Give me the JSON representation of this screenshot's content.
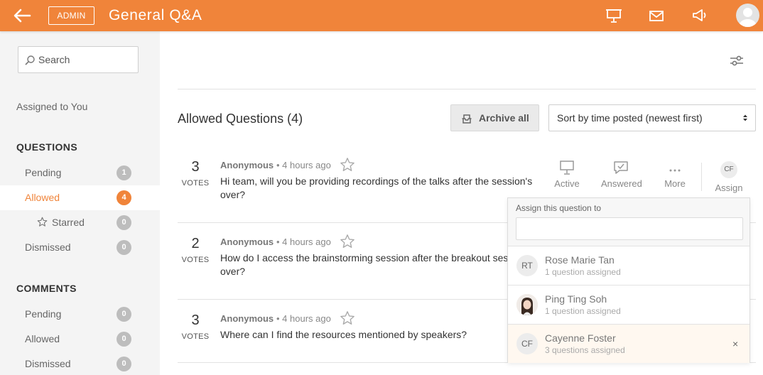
{
  "header": {
    "admin_label": "ADMIN",
    "title": "General Q&A",
    "accent_color": "#f0843a"
  },
  "sidebar": {
    "search_placeholder": "Search",
    "assigned_to_you": "Assigned to You",
    "questions_heading": "QUESTIONS",
    "questions": [
      {
        "label": "Pending",
        "count": "1"
      },
      {
        "label": "Allowed",
        "count": "4"
      },
      {
        "label": "Starred",
        "count": "0"
      },
      {
        "label": "Dismissed",
        "count": "0"
      }
    ],
    "comments_heading": "COMMENTS",
    "comments": [
      {
        "label": "Pending",
        "count": "0"
      },
      {
        "label": "Allowed",
        "count": "0"
      },
      {
        "label": "Dismissed",
        "count": "0"
      }
    ]
  },
  "main": {
    "list_title": "Allowed Questions (4)",
    "archive_label": "Archive all",
    "sort_label": "Sort by time posted (newest first)",
    "questions": [
      {
        "votes": "3",
        "votes_label": "VOTES",
        "author": "Anonymous",
        "time": "• 4 hours ago",
        "text": "Hi team, will you be providing recordings of the talks after the session's over?"
      },
      {
        "votes": "2",
        "votes_label": "VOTES",
        "author": "Anonymous",
        "time": "• 4 hours ago",
        "text": "How do I access the brainstorming session after the breakout session is over?"
      },
      {
        "votes": "3",
        "votes_label": "VOTES",
        "author": "Anonymous",
        "time": "• 4 hours ago",
        "text": "Where can I find the resources mentioned by speakers?"
      }
    ],
    "actions": {
      "active": "Active",
      "answered": "Answered",
      "more": "More",
      "assign": "Assign",
      "assign_initials": "CF"
    }
  },
  "assign_panel": {
    "title": "Assign this question to",
    "people": [
      {
        "initials": "RT",
        "name": "Rose Marie Tan",
        "assigned": "1 question assigned"
      },
      {
        "initials": "",
        "name": "Ping Ting Soh",
        "assigned": "1 question assigned"
      },
      {
        "initials": "CF",
        "name": "Cayenne Foster",
        "assigned": "3 questions assigned",
        "remove": "×"
      }
    ]
  }
}
